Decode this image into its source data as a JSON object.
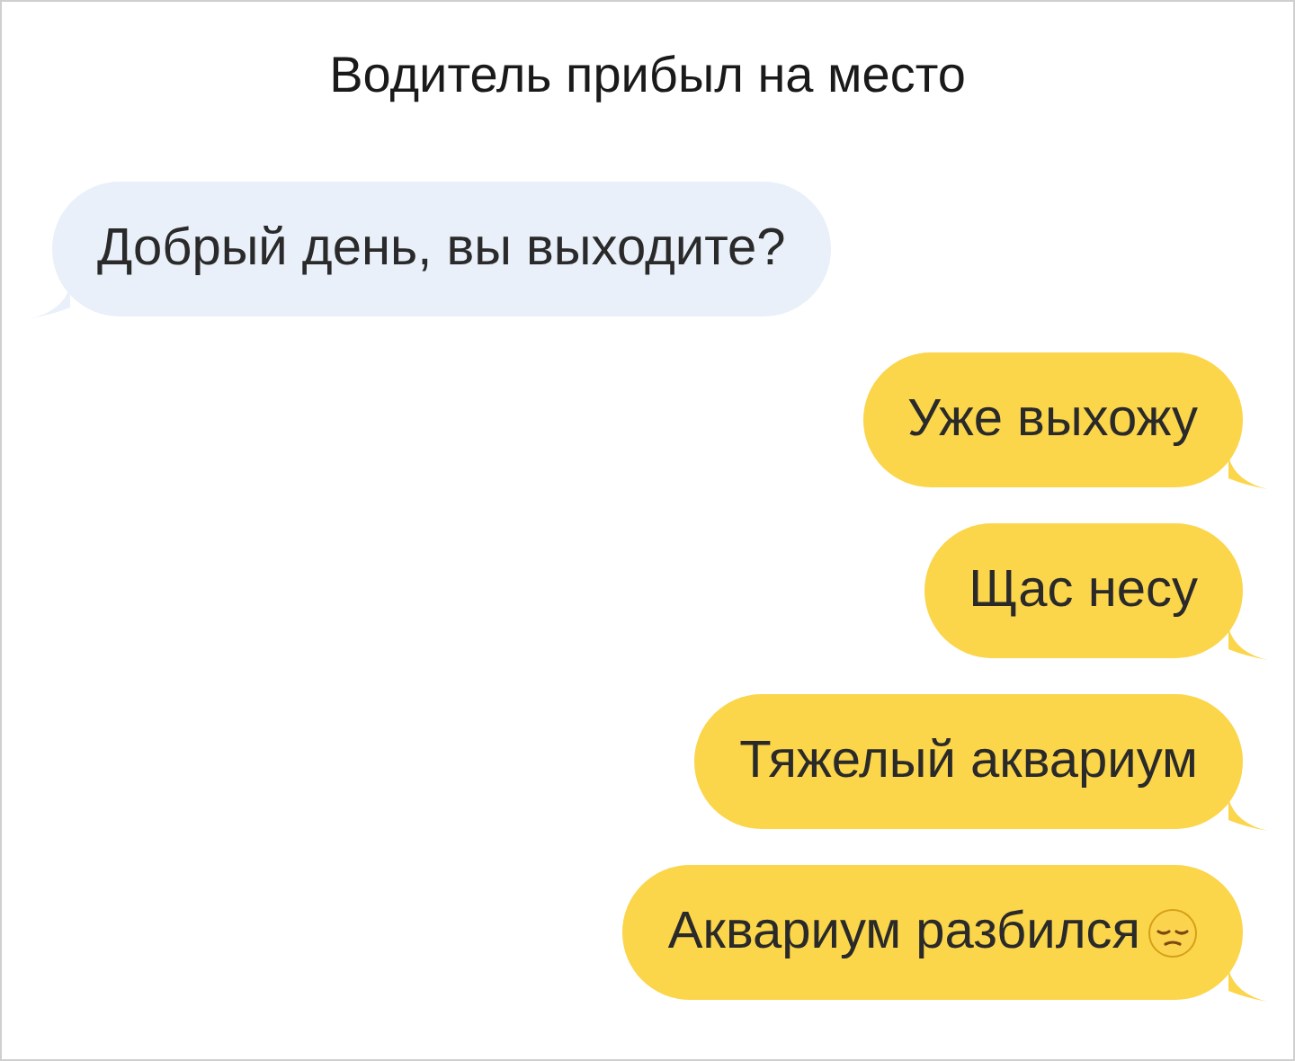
{
  "title": "Водитель прибыл на место",
  "messages": [
    {
      "kind": "incoming",
      "text": "Добрый день, вы выходите?"
    },
    {
      "kind": "outgoing",
      "text": "Уже выхожу"
    },
    {
      "kind": "outgoing",
      "text": "Щас несу"
    },
    {
      "kind": "outgoing",
      "text": "Тяжелый аквариум"
    },
    {
      "kind": "outgoing",
      "text": "Аквариум разбился",
      "emoji_shown": true
    }
  ]
}
